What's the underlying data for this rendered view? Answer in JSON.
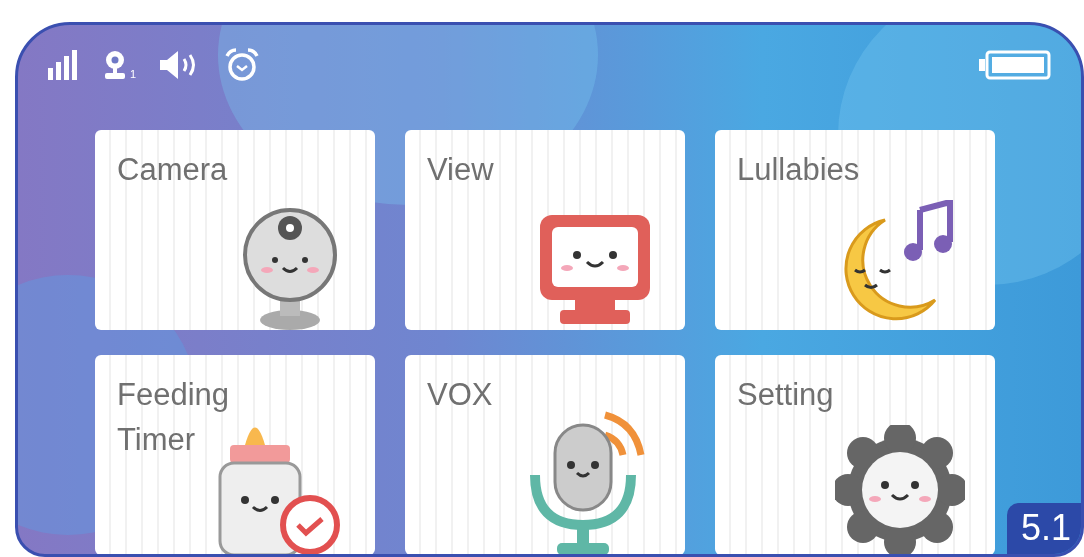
{
  "status_bar": {
    "camera_number": "1"
  },
  "tiles": [
    {
      "label": "Camera",
      "kind": "camera"
    },
    {
      "label": "View",
      "kind": "monitor"
    },
    {
      "label": "Lullabies",
      "kind": "moon"
    },
    {
      "label": "Feeding Timer",
      "kind": "bottle"
    },
    {
      "label": "VOX",
      "kind": "microphone"
    },
    {
      "label": "Setting",
      "kind": "gear"
    }
  ],
  "figure_label": "5.1"
}
